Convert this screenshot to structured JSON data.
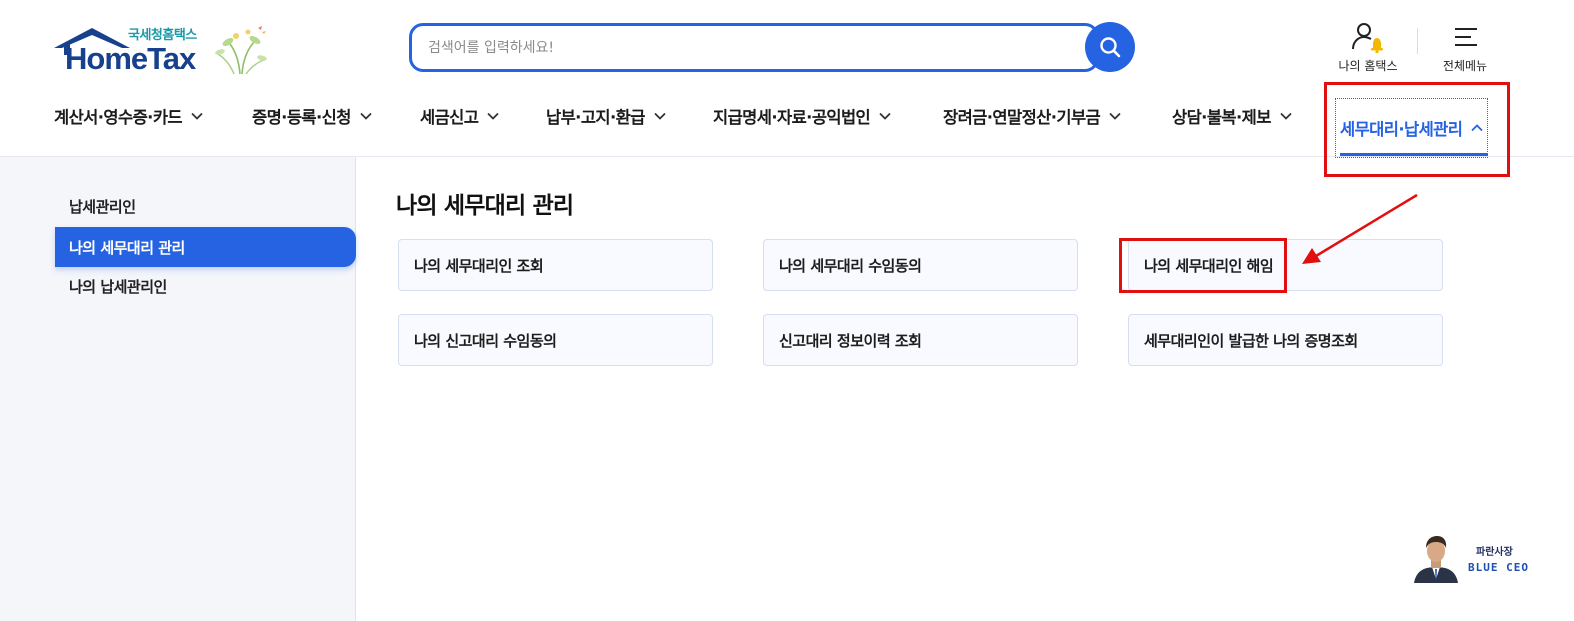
{
  "header": {
    "logo": {
      "korean": "국세청홈택스",
      "english": "HomeTax"
    },
    "search": {
      "placeholder": "검색어를 입력하세요!",
      "value": ""
    },
    "utilities": {
      "my_hometax": "나의 홈택스",
      "full_menu": "전체메뉴"
    },
    "gnb": [
      {
        "label": "계산서·영수증·카드",
        "expanded": false
      },
      {
        "label": "증명·등록·신청",
        "expanded": false
      },
      {
        "label": "세금신고",
        "expanded": false
      },
      {
        "label": "납부·고지·환급",
        "expanded": false
      },
      {
        "label": "지급명세·자료·공익법인",
        "expanded": false
      },
      {
        "label": "장려금·연말정산·기부금",
        "expanded": false
      },
      {
        "label": "상담·불복·제보",
        "expanded": false
      },
      {
        "label": "세무대리·납세관리",
        "expanded": true
      }
    ]
  },
  "sidebar": {
    "items": [
      {
        "label": "납세관리인",
        "active": false
      },
      {
        "label": "나의 세무대리 관리",
        "active": true
      },
      {
        "label": "나의 납세관리인",
        "active": false
      }
    ]
  },
  "main": {
    "title": "나의 세무대리 관리",
    "cards": [
      {
        "label": "나의 세무대리인 조회"
      },
      {
        "label": "나의 세무대리 수임동의"
      },
      {
        "label": "나의 세무대리인 해임"
      },
      {
        "label": "나의 신고대리 수임동의"
      },
      {
        "label": "신고대리 정보이력 조회"
      },
      {
        "label": "세무대리인이 발급한 나의 증명조회"
      }
    ]
  },
  "watermark": {
    "korean": "파란사장",
    "english": "BLUE CEO"
  },
  "colors": {
    "accent": "#2563e3",
    "annotation": "#e10f0f",
    "logo_navy": "#17418d",
    "logo_teal": "#1a9aa8",
    "sidebar_bg": "#f4f6fa"
  },
  "icons": {
    "search": "search-icon",
    "user_bell": "user-bell-icon",
    "menu": "hamburger-menu-icon",
    "chevron_down": "chevron-down-icon",
    "chevron_up": "chevron-up-icon"
  }
}
